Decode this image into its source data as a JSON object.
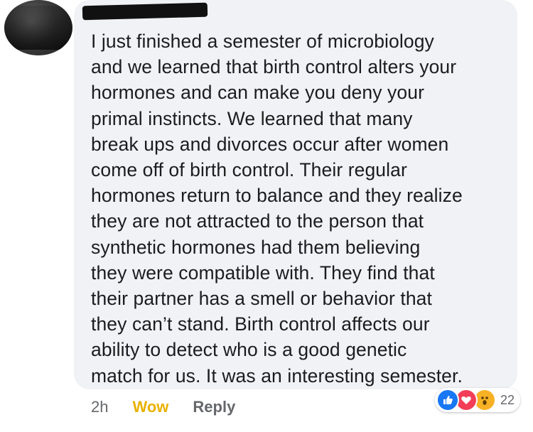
{
  "comment": {
    "author_name_redacted": true,
    "text": "I just finished a semester of microbiology\nand we learned that birth control alters your\nhormones and can make you deny your\nprimal instincts. We learned that many\nbreak ups and divorces occur after women\ncome off of birth control. Their regular\nhormones return to balance and they realize\nthey are not attracted to the person that\nsynthetic hormones had them believing\nthey were compatible with. They find that\ntheir partner has a smell or behavior that\nthey can’t stand. Birth control affects our\nability to detect who is a good genetic\nmatch for us. It was an interesting semester."
  },
  "actions": {
    "time": "2h",
    "reaction_label": "Wow",
    "reply_label": "Reply"
  },
  "reactions": {
    "icons": [
      "like-icon",
      "love-icon",
      "wow-face-icon"
    ],
    "count": "22"
  },
  "colors": {
    "bubble_bg": "#f0f2f5",
    "wow": "#e9b100",
    "like": "#1877f2",
    "love": "#f33e58",
    "wow_face": "#f7b125"
  }
}
